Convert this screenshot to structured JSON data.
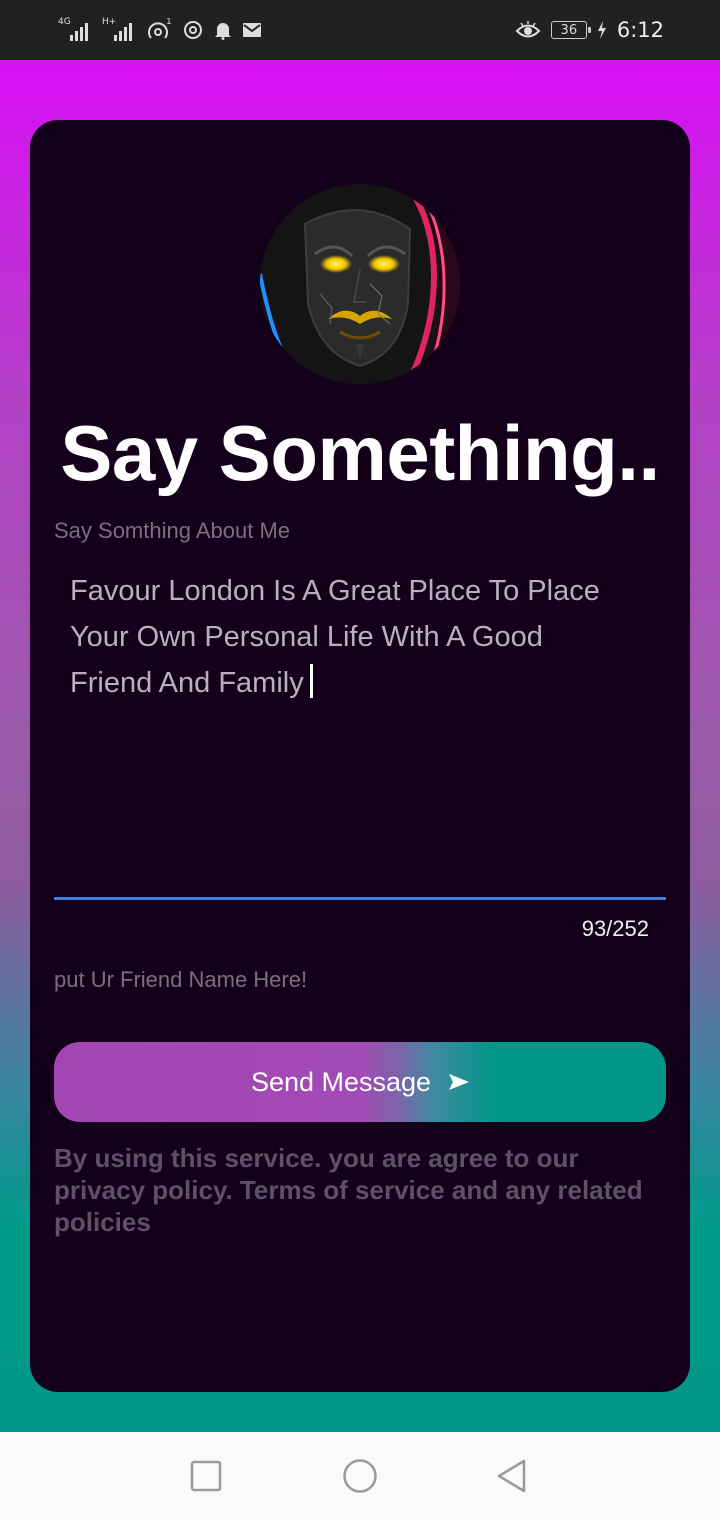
{
  "status_bar": {
    "network_left": "4G",
    "network_right": "H+",
    "notification_count": "1",
    "battery": "36",
    "time": "6:12"
  },
  "app": {
    "title": "Say Something..",
    "message_field": {
      "label": "Say Somthing About Me",
      "value": "Favour London Is A Great Place To Place Your Own Personal Life With A Good Friend And Family",
      "counter": "93/252"
    },
    "friend_field": {
      "placeholder": "put Ur Friend Name Here!"
    },
    "send_button_label": "Send Message",
    "terms_text": "By using this service. you are agree to our privacy policy. Terms of service and any related policies"
  },
  "colors": {
    "card_bg": "#15001c",
    "gradient_top": "#d80ff5",
    "gradient_bottom": "#009688",
    "accent_underline": "#3d7fe0",
    "button_left": "#a346b4",
    "button_right": "#009688"
  },
  "icons": {
    "avatar": "anonymous-mask-avatar",
    "send": "send-arrow-icon",
    "nav": [
      "recent-apps-square-icon",
      "home-circle-icon",
      "back-triangle-icon"
    ]
  }
}
